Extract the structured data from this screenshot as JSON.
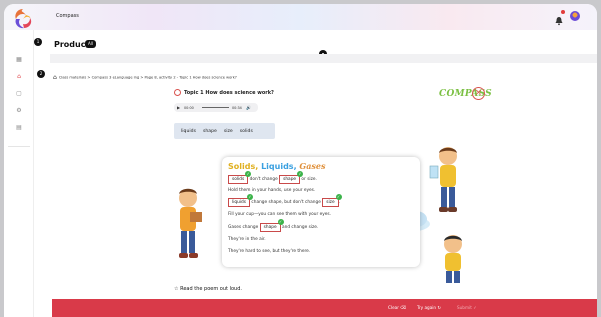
{
  "header": {
    "app_name": "Compass"
  },
  "page": {
    "title": "Products",
    "count_badge": "All"
  },
  "badges": {
    "b1": "1",
    "b2": "2"
  },
  "breadcrumb": "Class materials  >  Compass 3 eLanguage ing  >  Page 8, activity 2 - Topic 1 How does science work?",
  "activity": {
    "title": "Topic 1 How does science work?",
    "brand": "COMPASS",
    "audio": {
      "current": "00:00",
      "total": "00:34"
    },
    "word_bank": [
      "liquids",
      "shape",
      "size",
      "solids"
    ],
    "poem": {
      "title_parts": [
        "Solids,",
        "Liquids,",
        "Gases"
      ],
      "lines": [
        {
          "pre": "",
          "answer": "solids",
          "post": " don't change ",
          "answer2": "shape",
          "post2": " or size."
        },
        {
          "pre": "Hold them in your hands, use your eyes."
        },
        {
          "pre": "",
          "answer": "liquids",
          "post": " change shape, but don't change ",
          "answer2": "size",
          "post2": "."
        },
        {
          "pre": "Fill your cup—you can see them with your eyes."
        },
        {
          "pre": "Gases change ",
          "answer": "shape",
          "post": " and change size."
        },
        {
          "pre": "They're in the air."
        },
        {
          "pre": "They're hard to see, but they're there."
        }
      ]
    },
    "instruction": "Read the poem out loud."
  },
  "footer": {
    "clear": "Clear",
    "try_again": "Try again",
    "submit": "Submit"
  },
  "colors": {
    "accent": "#d93a49",
    "brand_green": "#7bc043"
  }
}
